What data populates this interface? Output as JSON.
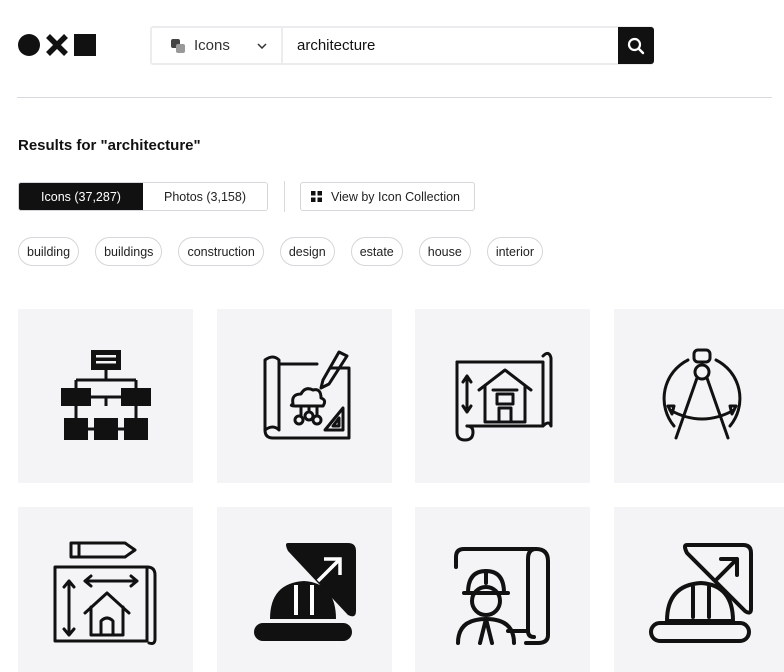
{
  "header": {
    "logo_icons": [
      "circle-icon",
      "x-icon",
      "square-icon"
    ],
    "search": {
      "type_label": "Icons",
      "query": "architecture",
      "placeholder": ""
    }
  },
  "results": {
    "title": "Results for \"architecture\"",
    "tabs": [
      {
        "label": "Icons (37,287)",
        "active": true
      },
      {
        "label": "Photos (3,158)",
        "active": false
      }
    ],
    "view_collection_label": "View by Icon Collection"
  },
  "tags": [
    "building",
    "buildings",
    "construction",
    "design",
    "estate",
    "house",
    "interior"
  ],
  "icons": [
    "org-chart-icon",
    "blueprint-cloud-icon",
    "house-blueprint-icon",
    "compass-drawing-icon",
    "house-plan-icon",
    "helmet-ruler-icon",
    "engineer-blueprint-icon",
    "helmet-ruler-outline-icon"
  ],
  "colors": {
    "accent": "#111111",
    "tile_bg": "#f4f4f6",
    "border": "#d6d6db"
  }
}
